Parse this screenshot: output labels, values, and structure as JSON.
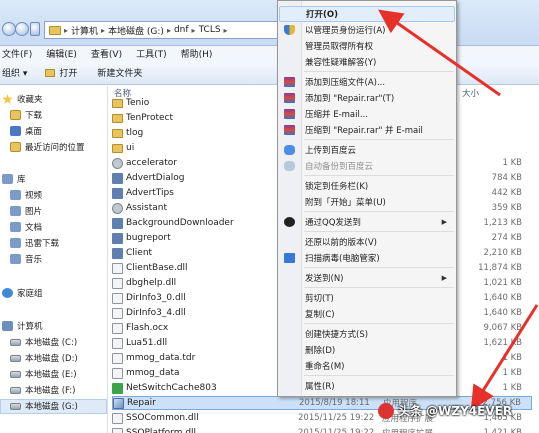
{
  "address": {
    "path": [
      "计算机",
      "本地磁盘 (G:)",
      "dnf",
      "TCLS"
    ]
  },
  "menubar": {
    "items": [
      "文件(F)",
      "编辑(E)",
      "查看(V)",
      "工具(T)",
      "帮助(H)"
    ]
  },
  "toolbar": {
    "organize": "组织 ▾",
    "open": "打开",
    "new_folder": "新建文件夹"
  },
  "navpane": {
    "favorites": "收藏夹",
    "downloads": "下载",
    "desktop": "桌面",
    "recent": "最近访问的位置",
    "libraries": "库",
    "videos": "视频",
    "pictures": "图片",
    "documents": "文档",
    "xunlei": "迅雷下载",
    "music": "音乐",
    "homegroup": "家庭组",
    "computer": "计算机",
    "drives": [
      "本地磁盘 (C:)",
      "本地磁盘 (D:)",
      "本地磁盘 (E:)",
      "本地磁盘 (F:)",
      "本地磁盘 (G:)"
    ]
  },
  "filelist": {
    "col_name": "名称",
    "col_size": "大小",
    "rows": [
      {
        "name": "Tenio",
        "icon": "folder",
        "date": "",
        "type": "",
        "size": ""
      },
      {
        "name": "TenProtect",
        "icon": "folder",
        "date": "",
        "type": "",
        "size": ""
      },
      {
        "name": "tlog",
        "icon": "folder",
        "date": "",
        "type": "",
        "size": ""
      },
      {
        "name": "ui",
        "icon": "folder",
        "date": "",
        "type": "",
        "size": ""
      },
      {
        "name": "accelerator",
        "icon": "gear",
        "date": "",
        "type": "",
        "size": "1 KB"
      },
      {
        "name": "AdvertDialog",
        "icon": "app",
        "date": "",
        "type": "",
        "size": "784 KB"
      },
      {
        "name": "AdvertTips",
        "icon": "app",
        "date": "",
        "type": "",
        "size": "442 KB"
      },
      {
        "name": "Assistant",
        "icon": "gear",
        "date": "",
        "type": "",
        "size": "359 KB"
      },
      {
        "name": "BackgroundDownloader",
        "icon": "app",
        "date": "",
        "type": "",
        "size": "1,213 KB"
      },
      {
        "name": "bugreport",
        "icon": "app",
        "date": "",
        "type": "",
        "size": "274 KB"
      },
      {
        "name": "Client",
        "icon": "app",
        "date": "",
        "type": "",
        "size": "2,210 KB"
      },
      {
        "name": "ClientBase.dll",
        "icon": "dll",
        "date": "",
        "type": "",
        "size": "11,874 KB"
      },
      {
        "name": "dbghelp.dll",
        "icon": "dll",
        "date": "",
        "type": "",
        "size": "1,021 KB"
      },
      {
        "name": "DirInfo3_0.dll",
        "icon": "dll",
        "date": "",
        "type": "",
        "size": "1,640 KB"
      },
      {
        "name": "DirInfo3_4.dll",
        "icon": "dll",
        "date": "",
        "type": "",
        "size": "1,640 KB"
      },
      {
        "name": "Flash.ocx",
        "icon": "dll",
        "date": "",
        "type": "",
        "size": "9,067 KB"
      },
      {
        "name": "Lua51.dll",
        "icon": "dll",
        "date": "",
        "type": "",
        "size": "1,621 KB"
      },
      {
        "name": "mmog_data.tdr",
        "icon": "dll",
        "date": "",
        "type": "",
        "size": "1 KB"
      },
      {
        "name": "mmog_data",
        "icon": "dll",
        "date": "",
        "type": "",
        "size": "1 KB"
      },
      {
        "name": "NetSwitchCache803",
        "icon": "green",
        "date": "",
        "type": "",
        "size": "1 KB"
      },
      {
        "name": "Repair",
        "icon": "repair",
        "date": "2015/8/19 18:11",
        "type": "应用程序",
        "size": "2,756 KB"
      },
      {
        "name": "SSOCommon.dll",
        "icon": "dll",
        "date": "2015/11/25 19:22",
        "type": "应用程序扩展",
        "size": "1,465 KB"
      },
      {
        "name": "SSOPlatform.dll",
        "icon": "dll",
        "date": "2015/11/25 19:22",
        "type": "应用程序扩展",
        "size": "1,421 KB"
      }
    ]
  },
  "context_menu": {
    "items": [
      {
        "label": "打开(O)",
        "icon": "",
        "bold": true,
        "hl": true
      },
      {
        "label": "以管理员身份运行(A)",
        "icon": "shield"
      },
      {
        "label": "管理员取得所有权",
        "icon": ""
      },
      {
        "label": "兼容性疑难解答(Y)",
        "icon": ""
      },
      {
        "label": "添加到压缩文件(A)...",
        "icon": "rar"
      },
      {
        "label": "添加到 \"Repair.rar\"(T)",
        "icon": "rar"
      },
      {
        "label": "压缩并 E-mail...",
        "icon": "rar"
      },
      {
        "label": "压缩到 \"Repair.rar\" 并 E-mail",
        "icon": "rar"
      },
      {
        "label": "上传到百度云",
        "icon": "cloud"
      },
      {
        "label": "自动备份到百度云",
        "icon": "cloudd",
        "dis": true
      },
      {
        "label": "锁定到任务栏(K)",
        "icon": ""
      },
      {
        "label": "附到「开始」菜单(U)",
        "icon": ""
      },
      {
        "label": "通过QQ发送到",
        "icon": "qq",
        "sub": true
      },
      {
        "label": "还原以前的版本(V)",
        "icon": ""
      },
      {
        "label": "扫描病毒(电脑管家)",
        "icon": "scan"
      },
      {
        "label": "发送到(N)",
        "icon": "",
        "sub": true
      },
      {
        "label": "剪切(T)",
        "icon": ""
      },
      {
        "label": "复制(C)",
        "icon": ""
      },
      {
        "label": "创建快捷方式(S)",
        "icon": ""
      },
      {
        "label": "删除(D)",
        "icon": ""
      },
      {
        "label": "重命名(M)",
        "icon": ""
      },
      {
        "label": "属性(R)",
        "icon": ""
      }
    ]
  },
  "watermark": "头条 @WZY4EVER",
  "colors": {
    "arrow": "#e8302a",
    "selection": "#cce1f7"
  }
}
